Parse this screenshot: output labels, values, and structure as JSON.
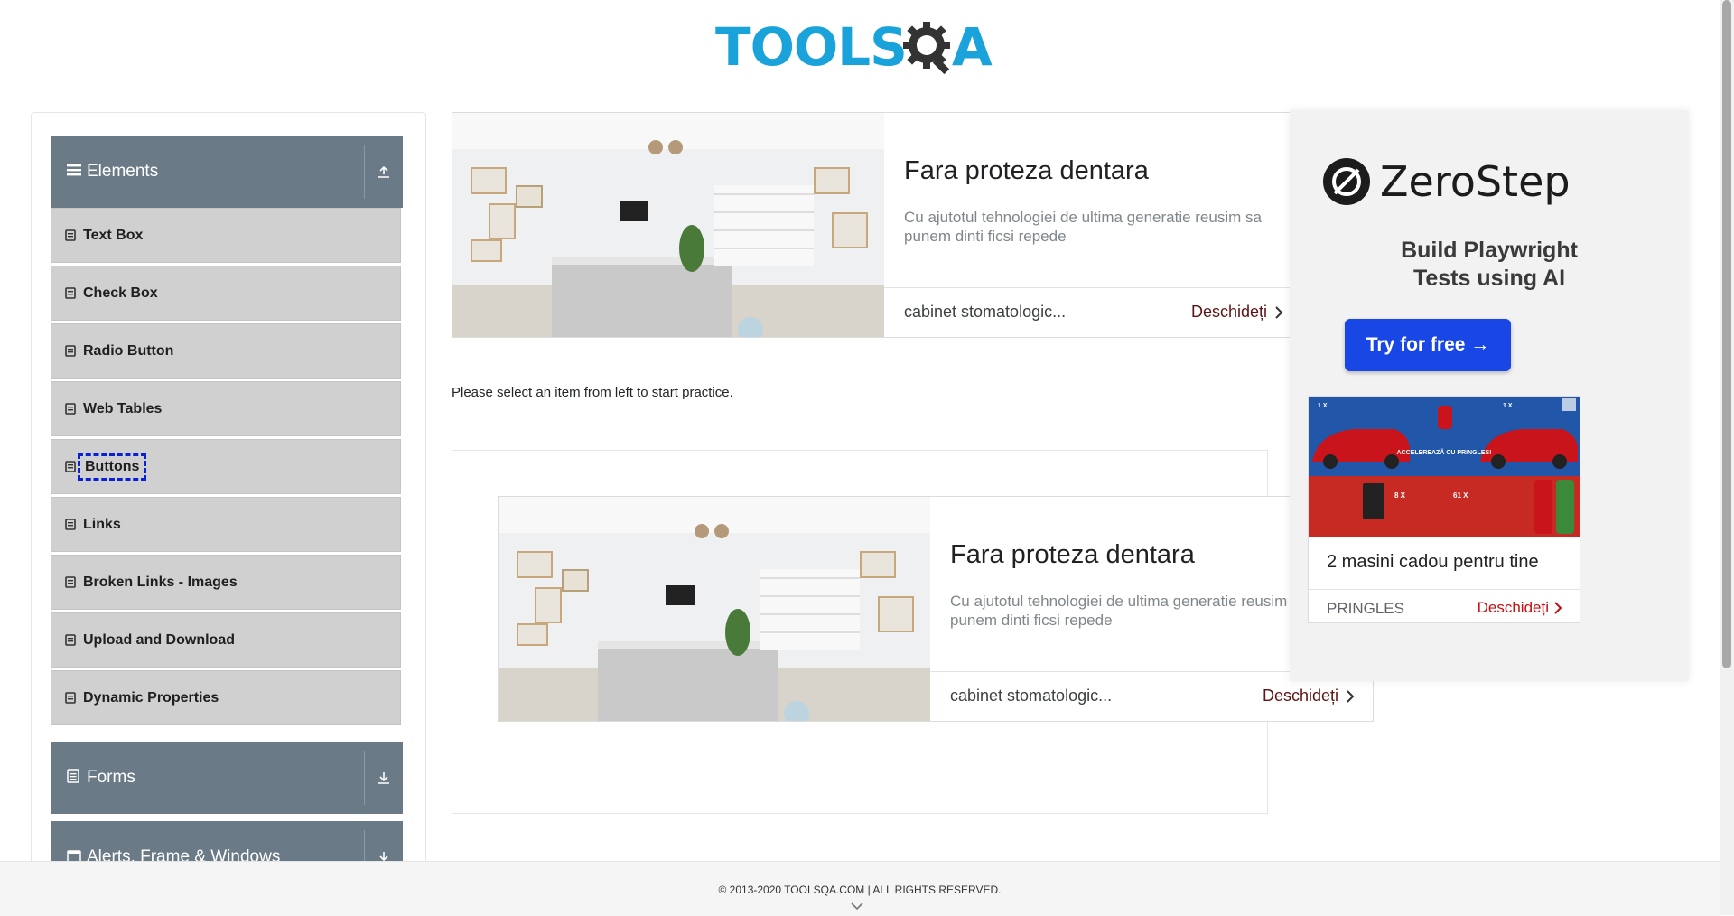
{
  "header": {
    "logo_part1": "TOOLS",
    "logo_part2": "A"
  },
  "sidebar": {
    "elements_group": {
      "label": "Elements",
      "toggle_icon": "collapse-up-icon"
    },
    "items": [
      {
        "label": "Text Box"
      },
      {
        "label": "Check Box"
      },
      {
        "label": "Radio Button"
      },
      {
        "label": "Web Tables"
      },
      {
        "label": "Buttons",
        "focused": true
      },
      {
        "label": "Links"
      },
      {
        "label": "Broken Links - Images"
      },
      {
        "label": "Upload and Download"
      },
      {
        "label": "Dynamic Properties"
      }
    ],
    "forms_group": {
      "label": "Forms",
      "toggle_icon": "expand-down-icon"
    },
    "alerts_group": {
      "label": "Alerts, Frame & Windows",
      "toggle_icon": "expand-down-icon"
    }
  },
  "main": {
    "ad_top": {
      "title": "Fara proteza dentara",
      "description": "Cu ajutotul tehnologiei de ultima generatie reusim sa punem dinti ficsi repede",
      "source": "cabinet stomatologic...",
      "cta": "Deschideți"
    },
    "practice_text": "Please select an item from left to start practice.",
    "ad_frame": {
      "title": "Fara proteza dentara",
      "description": "Cu ajutotul tehnologiei de ultima generatie reusim sa punem dinti ficsi repede",
      "source": "cabinet stomatologic...",
      "cta": "Deschideți"
    }
  },
  "right_ad": {
    "brand": "ZeroStep",
    "tagline_line1": "Build Playwright",
    "tagline_line2": "Tests using AI",
    "button": "Try for free →",
    "pringles": {
      "text": "2 masini cadou pentru tine",
      "source": "PRINGLES",
      "cta": "Deschideți",
      "banner_text": "ACCELEREAZĂ CU PRINGLES!",
      "badge_1x_left": "1 X",
      "badge_1x_right": "1 X",
      "badge_8x": "8 X",
      "badge_61x": "61 X"
    }
  },
  "footer": {
    "copyright": "© 2013-2020 TOOLSQA.COM | ALL RIGHTS RESERVED."
  },
  "colors": {
    "accent": "#1aa3da",
    "group_header": "#6a7a86",
    "menu_item": "#d0d0d0",
    "focus_outline": "#0a1fd9",
    "zs_button": "#1847e5"
  }
}
